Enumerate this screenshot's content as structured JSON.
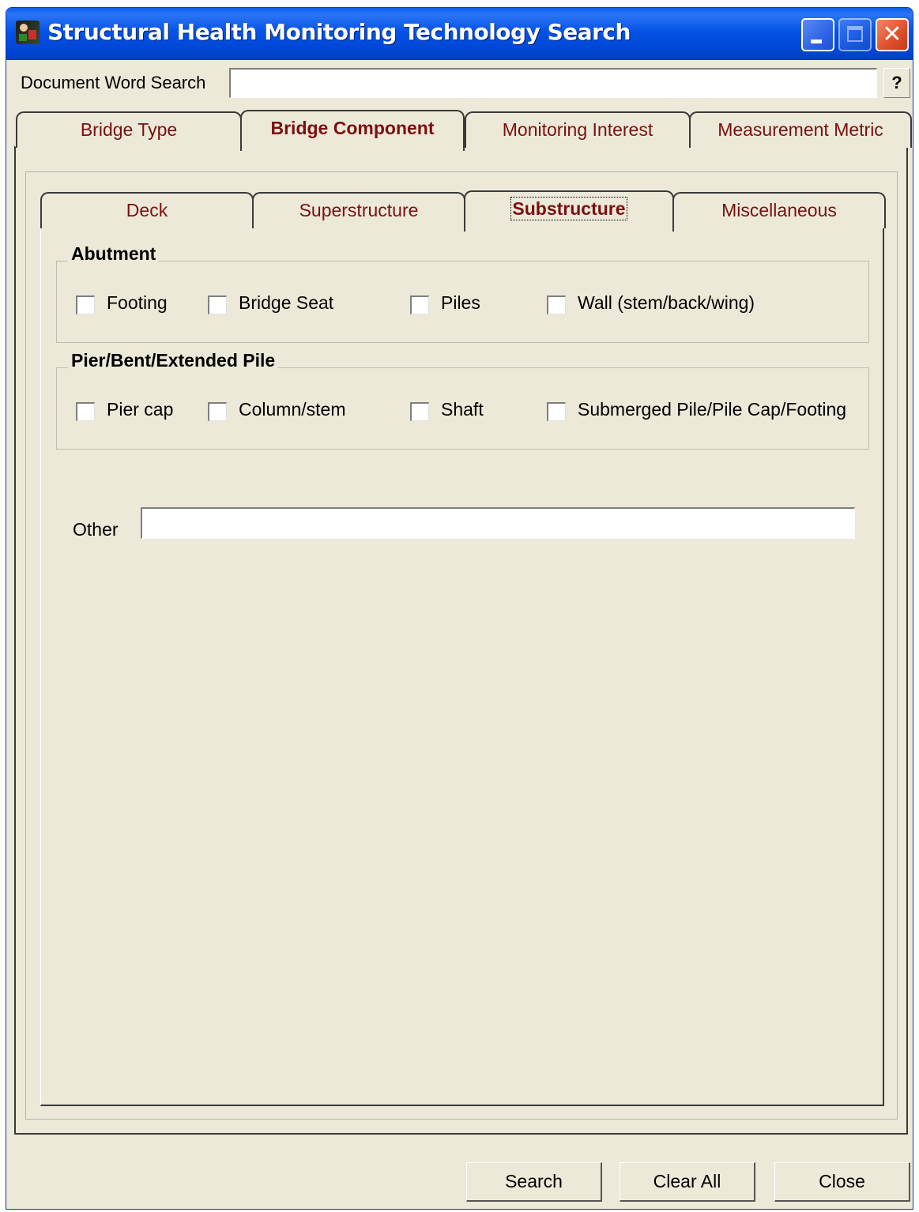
{
  "window": {
    "title": "Structural Health Monitoring Technology Search"
  },
  "search": {
    "label": "Document Word Search",
    "value": "",
    "help_label": "?"
  },
  "main_tabs": [
    {
      "label": "Bridge Type",
      "active": false
    },
    {
      "label": "Bridge Component",
      "active": true
    },
    {
      "label": "Monitoring Interest",
      "active": false
    },
    {
      "label": "Measurement Metric",
      "active": false
    }
  ],
  "sub_tabs": [
    {
      "label": "Deck",
      "active": false
    },
    {
      "label": "Superstructure",
      "active": false
    },
    {
      "label": "Substructure",
      "active": true
    },
    {
      "label": "Miscellaneous",
      "active": false
    }
  ],
  "groups": [
    {
      "title": "Abutment",
      "items": [
        {
          "label": "Footing",
          "checked": false
        },
        {
          "label": "Bridge Seat",
          "checked": false
        },
        {
          "label": "Piles",
          "checked": false
        },
        {
          "label": "Wall (stem/back/wing)",
          "checked": false
        }
      ]
    },
    {
      "title": "Pier/Bent/Extended Pile",
      "items": [
        {
          "label": "Pier cap",
          "checked": false
        },
        {
          "label": "Column/stem",
          "checked": false
        },
        {
          "label": "Shaft",
          "checked": false
        },
        {
          "label": "Submerged Pile/Pile Cap/Footing",
          "checked": false
        }
      ]
    }
  ],
  "other": {
    "label": "Other",
    "value": ""
  },
  "buttons": {
    "search": "Search",
    "clear_all": "Clear All",
    "close": "Close"
  },
  "colors": {
    "title_bar": "#0553e6",
    "tab_text": "#7a1010",
    "dialog_bg": "#ece9d8"
  }
}
